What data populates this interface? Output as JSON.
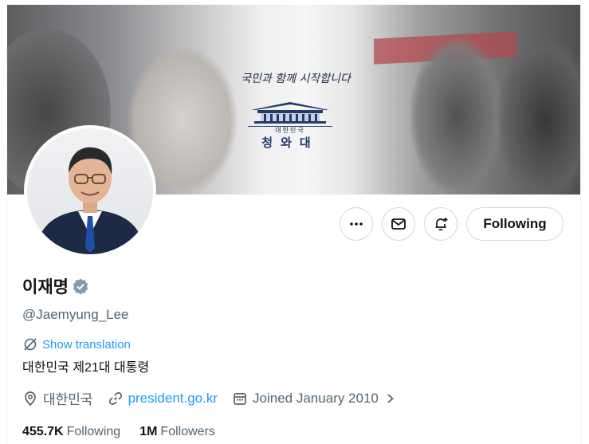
{
  "banner": {
    "caption": "국민과 함께 시작합니다",
    "emblem_sub": "대한민국",
    "emblem_name": "청와대"
  },
  "actions": {
    "more_icon": "more-icon",
    "message_icon": "envelope-icon",
    "notify_icon": "bell-plus-icon",
    "follow_label": "Following"
  },
  "profile": {
    "name": "이재명",
    "verified_icon": "verified-badge-icon",
    "handle": "@Jaemyung_Lee",
    "translate_label": "Show translation",
    "bio": "대한민국 제21대 대통령",
    "location": "대한민국",
    "website": "president.go.kr",
    "joined": "Joined January 2010"
  },
  "stats": {
    "following_count": "455.7K",
    "following_label": "Following",
    "followers_count": "1M",
    "followers_label": "Followers"
  },
  "colors": {
    "accent": "#1d9bf0",
    "secondary_text": "#536471",
    "border": "#cfd9de",
    "verified": "#829aab"
  }
}
